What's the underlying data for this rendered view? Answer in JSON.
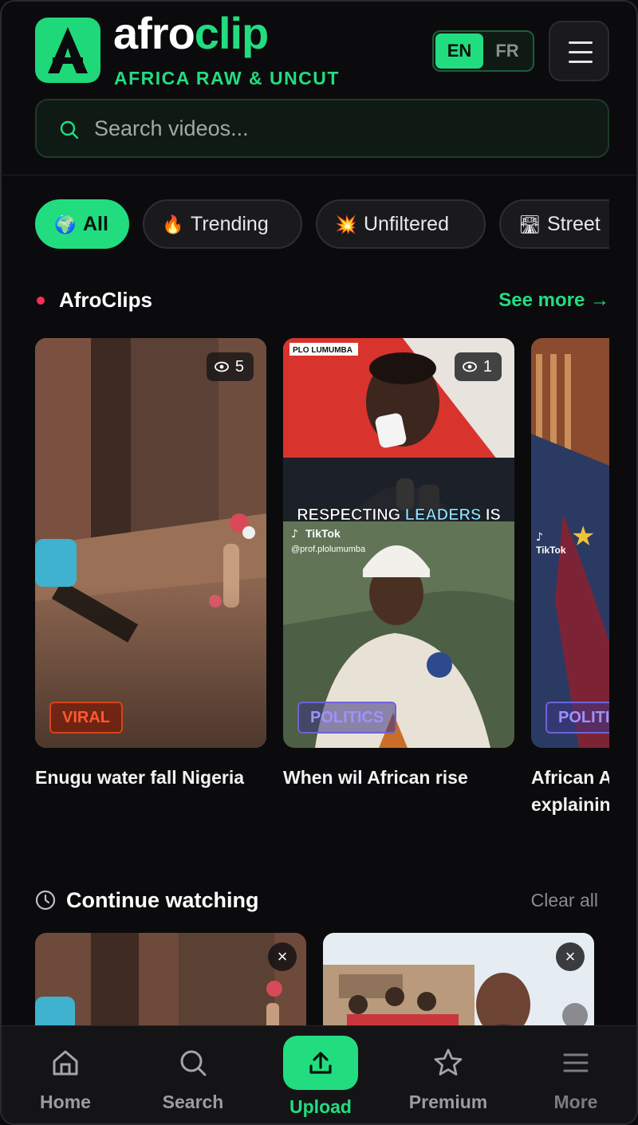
{
  "header": {
    "brand_part1": "afro",
    "brand_part2": "clip",
    "tagline": "AFRICA RAW & UNCUT",
    "lang_en": "EN",
    "lang_fr": "FR",
    "selected_language": "EN"
  },
  "search": {
    "placeholder": "Search videos..."
  },
  "chips": [
    {
      "icon": "globe-icon",
      "label": "All",
      "active": true
    },
    {
      "icon": "fire-icon",
      "label": "Trending",
      "active": false
    },
    {
      "icon": "explosion-icon",
      "label": "Unfiltered",
      "active": false
    },
    {
      "icon": "road-icon",
      "label": "Street",
      "active": false
    }
  ],
  "afroclips": {
    "title": "AfroClips",
    "see_more": "See more →",
    "items": [
      {
        "title": "Enugu water fall Nigeria",
        "views": "5",
        "badge": "VIRAL"
      },
      {
        "title": "When wil African rise",
        "views": "1",
        "badge": "POLITICS",
        "overlay_caption_1": "RESPECTING ",
        "overlay_caption_2": "LEADERS",
        "overlay_caption_3": " IS",
        "overlay_tag": "PLO LUMUMBA",
        "overlay_platform": "TikTok",
        "overlay_handle": "@prof.plolumumba"
      },
      {
        "title_line1": "African A",
        "title_line2": "explainin",
        "badge": "POLITIC",
        "overlay_platform": "TikTok"
      }
    ]
  },
  "continue_watching": {
    "title": "Continue watching",
    "clear_all": "Clear all",
    "close_glyph": "×"
  },
  "nav": [
    {
      "icon": "home-icon",
      "label": "Home"
    },
    {
      "icon": "search-icon",
      "label": "Search"
    },
    {
      "icon": "upload-icon",
      "label": "Upload",
      "active": true
    },
    {
      "icon": "star-icon",
      "label": "Premium"
    },
    {
      "icon": "menu-icon",
      "label": "More"
    }
  ],
  "colors": {
    "accent": "#22dd80",
    "background": "#0b0b0d",
    "viral": "#ff5a2e",
    "politics": "#9d92ff",
    "live_dot": "#ff2d55"
  }
}
